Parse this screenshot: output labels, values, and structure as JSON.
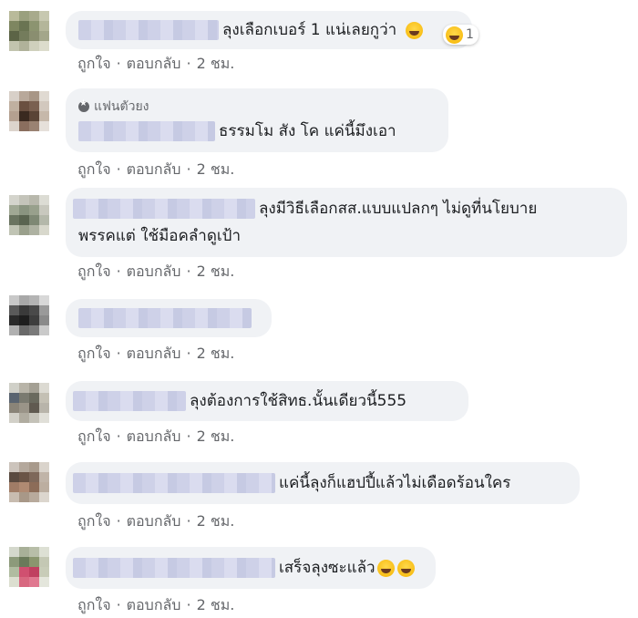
{
  "actions": {
    "like": "ถูกใจ",
    "reply": "ตอบกลับ",
    "separator": "·",
    "time": "2 ชม."
  },
  "comments": [
    {
      "text": "ลุงเลือกเบอร์ 1 แน่เลยกูว่า",
      "reaction_icon": "laughing-emoji-icon",
      "reaction_count": "1"
    },
    {
      "badge": "แฟนตัวยง",
      "text": "ธรรมโม สัง โค แค่นี้มึงเอา"
    },
    {
      "text_line1": "ลุงมีวิธีเลือกสส.แบบแปลกๆ ไม่ดูที่นโยบาย",
      "text_line2": "พรรคแต่ ใช้มือคลำดูเป้า"
    },
    {
      "text": ""
    },
    {
      "text": "ลุงต้องการใช้สิทธ.นั้นเดียวนี้555"
    },
    {
      "text": "แค่นี้ลุงก็แฮปปี้แล้วไม่เดือดร้อนใคร"
    },
    {
      "text": "เสร็จลุงซะแล้ว",
      "emoji_icon": "laughing-tears-emoji-icon"
    }
  ],
  "colors": {
    "bubble": "#f0f2f5",
    "meta_text": "#65676b",
    "text": "#1c1e21"
  }
}
